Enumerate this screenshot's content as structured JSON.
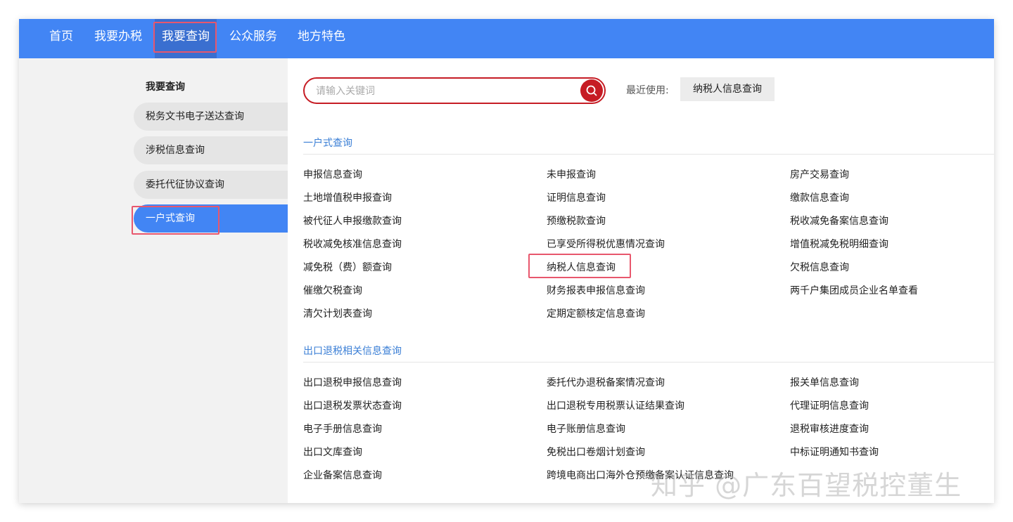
{
  "topnav": {
    "items": [
      "首页",
      "我要办税",
      "我要查询",
      "公众服务",
      "地方特色"
    ],
    "active_index": 2
  },
  "sidebar": {
    "heading": "我要查询",
    "items": [
      "税务文书电子送达查询",
      "涉税信息查询",
      "委托代征协议查询",
      "一户式查询"
    ],
    "active_index": 3
  },
  "search": {
    "placeholder": "请输入关键词",
    "button_icon": "search-icon"
  },
  "recent": {
    "label": "最近使用:",
    "tag": "纳税人信息查询"
  },
  "sections": [
    {
      "title": "一户式查询",
      "links": [
        "申报信息查询",
        "未申报查询",
        "房产交易查询",
        "土地增值税申报查询",
        "证明信息查询",
        "缴款信息查询",
        "被代征人申报缴款查询",
        "预缴税款查询",
        "税收减免备案信息查询",
        "税收减免核准信息查询",
        "已享受所得税优惠情况查询",
        "增值税减免税明细查询",
        "减免税（费）额查询",
        "纳税人信息查询",
        "欠税信息查询",
        "催缴欠税查询",
        "财务报表申报信息查询",
        "两千户集团成员企业名单查看",
        "清欠计划表查询",
        "定期定额核定信息查询"
      ]
    },
    {
      "title": "出口退税相关信息查询",
      "links": [
        "出口退税申报信息查询",
        "委托代办退税备案情况查询",
        "报关单信息查询",
        "出口退税发票状态查询",
        "出口退税专用税票认证结果查询",
        "代理证明信息查询",
        "电子手册信息查询",
        "电子账册信息查询",
        "退税审核进度查询",
        "出口文库查询",
        "免税出口卷烟计划查询",
        "中标证明通知书查询",
        "企业备案信息查询",
        "跨境电商出口海外仓预缴备案认证信息查询"
      ]
    }
  ],
  "watermark": "知乎 @广东百望税控董生",
  "colors": {
    "nav_blue": "#4285f4",
    "accent_red": "#c61c24",
    "highlight_pink": "#e8576d",
    "section_blue": "#3b7fd6"
  }
}
